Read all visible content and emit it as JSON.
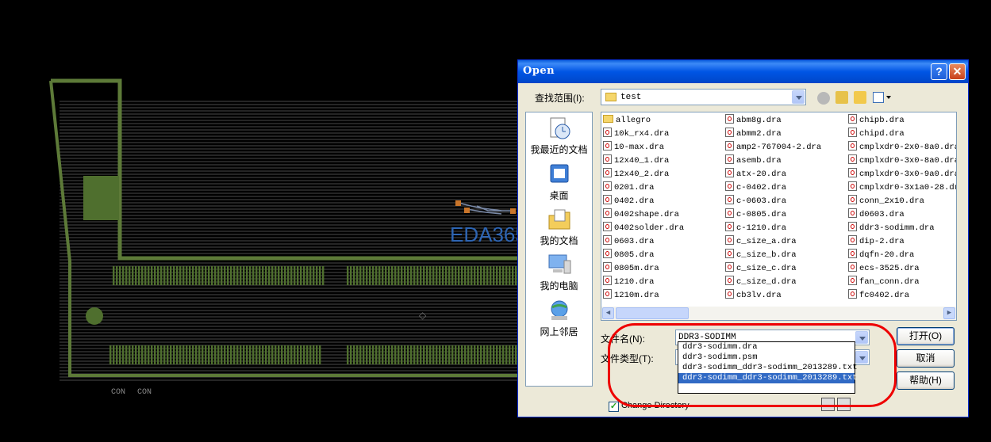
{
  "pcb": {
    "labels": [
      "CON",
      "CON"
    ],
    "accent": "#4f6f2e",
    "watermark": "EDA365"
  },
  "dialog": {
    "title": "Open",
    "help_button": "?",
    "close_button": "✕",
    "lookin_label": "查找范围(I):",
    "lookin_value": "test",
    "places": [
      {
        "label": "我最近的文档",
        "icon": "recent-documents-icon"
      },
      {
        "label": "桌面",
        "icon": "desktop-icon"
      },
      {
        "label": "我的文档",
        "icon": "my-documents-icon"
      },
      {
        "label": "我的电脑",
        "icon": "my-computer-icon"
      },
      {
        "label": "网上邻居",
        "icon": "network-places-icon"
      }
    ],
    "files": {
      "col1": [
        "allegro",
        "10k_rx4.dra",
        "10-max.dra",
        "12x40_1.dra",
        "12x40_2.dra",
        "0201.dra",
        "0402.dra",
        "0402shape.dra",
        "0402solder.dra",
        "0603.dra",
        "0805.dra",
        "0805m.dra",
        "1210.dra",
        "1210m.dra"
      ],
      "col2": [
        "abm8g.dra",
        "abmm2.dra",
        "amp2-767004-2.dra",
        "asemb.dra",
        "atx-20.dra",
        "c-0402.dra",
        "c-0603.dra",
        "c-0805.dra",
        "c-1210.dra",
        "c_size_a.dra",
        "c_size_b.dra",
        "c_size_c.dra",
        "c_size_d.dra",
        "cb3lv.dra"
      ],
      "col3": [
        "chipb.dra",
        "chipd.dra",
        "cmplxdr0-2x0-8a0.dra",
        "cmplxdr0-3x0-8a0.dra",
        "cmplxdr0-3x0-9a0.dra",
        "cmplxdr0-3x1a0-28.dr",
        "conn_2x10.dra",
        "d0603.dra",
        "ddr3-sodimm.dra",
        "dip-2.dra",
        "dqfn-20.dra",
        "ecs-3525.dra",
        "fan_conn.dra",
        "fc0402.dra"
      ]
    },
    "filename_label": "文件名(N):",
    "filename_value": "DDR3-SODIMM",
    "filetype_label": "文件类型(T):",
    "autocomplete": [
      "ddr3-sodimm.dra",
      "ddr3-sodimm.psm",
      "ddr3-sodimm_ddr3-sodimm_2013289.txt",
      "ddr3-sodimm_ddr3-sodimm_2013289.txt"
    ],
    "autocomplete_selected": 3,
    "open_button": "打开(O)",
    "cancel_button": "取消",
    "help_text_button": "帮助(H)",
    "change_directory_label": "Change Directory",
    "change_directory_checked": "✓"
  }
}
